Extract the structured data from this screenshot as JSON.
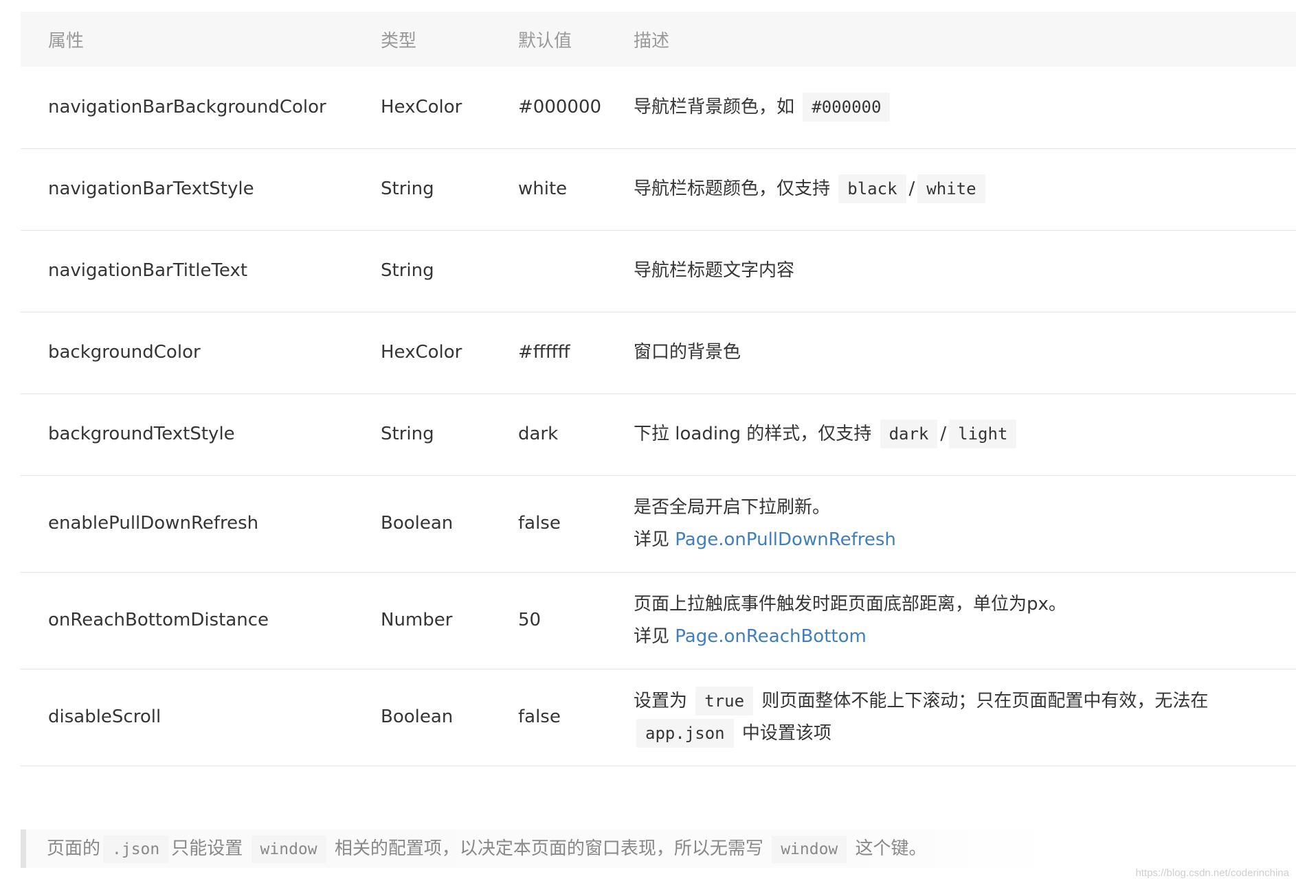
{
  "table": {
    "headers": [
      "属性",
      "类型",
      "默认值",
      "描述"
    ],
    "rows": [
      {
        "property": "navigationBarBackgroundColor",
        "type": "HexColor",
        "default": "#000000",
        "desc_text": "导航栏背景颜色，如",
        "desc_code": "#000000"
      },
      {
        "property": "navigationBarTextStyle",
        "type": "String",
        "default": "white",
        "desc_text": "导航栏标题颜色，仅支持",
        "desc_code_1": "black",
        "desc_sep": "/",
        "desc_code_2": "white"
      },
      {
        "property": "navigationBarTitleText",
        "type": "String",
        "default": "",
        "desc_text": "导航栏标题文字内容"
      },
      {
        "property": "backgroundColor",
        "type": "HexColor",
        "default": "#ffffff",
        "desc_text": "窗口的背景色"
      },
      {
        "property": "backgroundTextStyle",
        "type": "String",
        "default": "dark",
        "desc_text": "下拉 loading 的样式，仅支持",
        "desc_code_1": "dark",
        "desc_sep": "/",
        "desc_code_2": "light"
      },
      {
        "property": "enablePullDownRefresh",
        "type": "Boolean",
        "default": "false",
        "desc_line1": "是否全局开启下拉刷新。",
        "desc_see": "详见",
        "desc_link": "Page.onPullDownRefresh"
      },
      {
        "property": "onReachBottomDistance",
        "type": "Number",
        "default": "50",
        "desc_line1": "页面上拉触底事件触发时距页面底部距离，单位为px。",
        "desc_see": "详见",
        "desc_link": "Page.onReachBottom"
      },
      {
        "property": "disableScroll",
        "type": "Boolean",
        "default": "false",
        "desc_pre": "设置为",
        "desc_code_1": "true",
        "desc_mid": "则页面整体不能上下滚动；只在页面配置中有效，无法在",
        "desc_code_2": "app.json",
        "desc_post": "中设置该项"
      }
    ]
  },
  "note": {
    "text_1": "页面的",
    "code_1": ".json",
    "text_2": "只能设置",
    "code_2": "window",
    "text_3": "相关的配置项，以决定本页面的窗口表现，所以无需写",
    "code_3": "window",
    "text_4": "这个键。"
  },
  "watermark": "https://blog.csdn.net/coderinchina",
  "colors": {
    "link": "#3f7fbf",
    "header_bg": "#f7f7f7",
    "code_bg": "#f5f5f5",
    "text": "#353535",
    "muted": "#999999"
  }
}
